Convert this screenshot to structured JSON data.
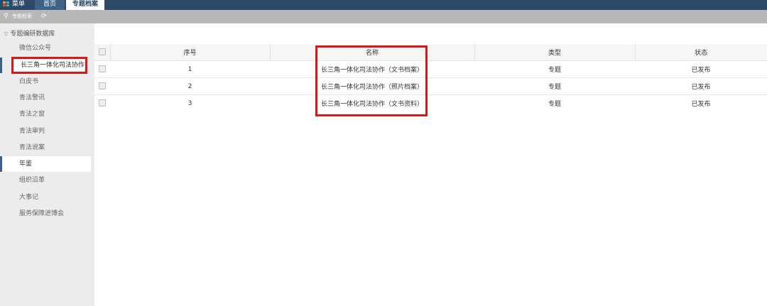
{
  "top_tabs": {
    "menu": "菜单",
    "home": "首页",
    "topic": "专题档案"
  },
  "toolbar": {
    "label": "专题检索"
  },
  "sidebar": {
    "root": "专题编研数据库",
    "items": [
      {
        "label": "微信公众号"
      },
      {
        "label": "长三角一体化司法协作"
      },
      {
        "label": "白皮书"
      },
      {
        "label": "青法警讯"
      },
      {
        "label": "青法之窗"
      },
      {
        "label": "青法审判"
      },
      {
        "label": "青法说案"
      },
      {
        "label": "年鉴"
      },
      {
        "label": "组织沿革"
      },
      {
        "label": "大事记"
      },
      {
        "label": "服务保障进博会"
      }
    ]
  },
  "table": {
    "headers": [
      "序号",
      "名称",
      "类型",
      "状态"
    ],
    "rows": [
      {
        "no": "1",
        "name": "长三角一体化司法协作（文书档案）",
        "type": "专题",
        "status": "已发布"
      },
      {
        "no": "2",
        "name": "长三角一体化司法协作（照片档案）",
        "type": "专题",
        "status": "已发布"
      },
      {
        "no": "3",
        "name": "长三角一体化司法协作（文书资料）",
        "type": "专题",
        "status": "已发布"
      }
    ]
  },
  "colors": {
    "topbar": "#2c4a68",
    "highlight": "#d21a1a",
    "sidebar": "#ececec"
  }
}
